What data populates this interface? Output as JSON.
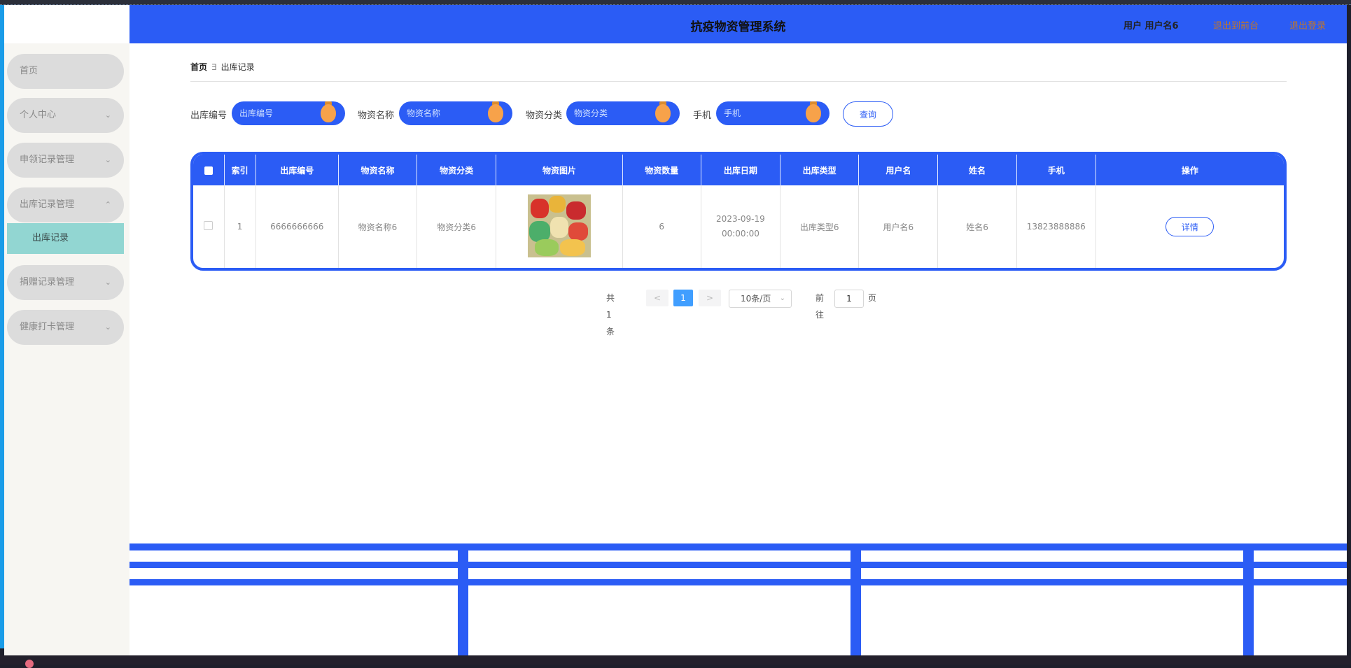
{
  "header": {
    "title": "抗疫物资管理系统",
    "user_label": "用户 用户名6",
    "back_front_label": "退出到前台",
    "logout_label": "退出登录"
  },
  "sidebar": {
    "items": [
      {
        "label": "首页",
        "chevron": ""
      },
      {
        "label": "个人中心",
        "chevron": "⌄"
      },
      {
        "label": "申领记录管理",
        "chevron": "⌄"
      },
      {
        "label": "出库记录管理",
        "chevron": "⌃"
      },
      {
        "label": "捐赠记录管理",
        "chevron": "⌄"
      },
      {
        "label": "健康打卡管理",
        "chevron": "⌄"
      }
    ],
    "subitem": "出库记录"
  },
  "breadcrumb": {
    "home": "首页",
    "separator": "∃",
    "current": "出库记录"
  },
  "search": {
    "fields": [
      {
        "label": "出库编号",
        "placeholder": "出库编号"
      },
      {
        "label": "物资名称",
        "placeholder": "物资名称"
      },
      {
        "label": "物资分类",
        "placeholder": "物资分类"
      },
      {
        "label": "手机",
        "placeholder": "手机"
      }
    ],
    "button_label": "查询"
  },
  "table": {
    "columns": [
      "索引",
      "出库编号",
      "物资名称",
      "物资分类",
      "物资图片",
      "物资数量",
      "出库日期",
      "出库类型",
      "用户名",
      "姓名",
      "手机",
      "操作"
    ],
    "rows": [
      {
        "index": "1",
        "code": "6666666666",
        "name": "物资名称6",
        "category": "物资分类6",
        "quantity": "6",
        "date": "2023-09-19 00:00:00",
        "type": "出库类型6",
        "username": "用户名6",
        "realname": "姓名6",
        "phone": "13823888886",
        "action": "详情"
      }
    ]
  },
  "pagination": {
    "total": "共 1 条",
    "prev": "<",
    "current": "1",
    "next": ">",
    "page_size": "10条/页",
    "goto_label": "前往",
    "goto_value": "1",
    "page_suffix": "页"
  },
  "colors": {
    "primary": "#2b5cf5",
    "active_sub": "#92d6d2",
    "badge": "#f7a24a",
    "pager_active": "#409eff"
  }
}
